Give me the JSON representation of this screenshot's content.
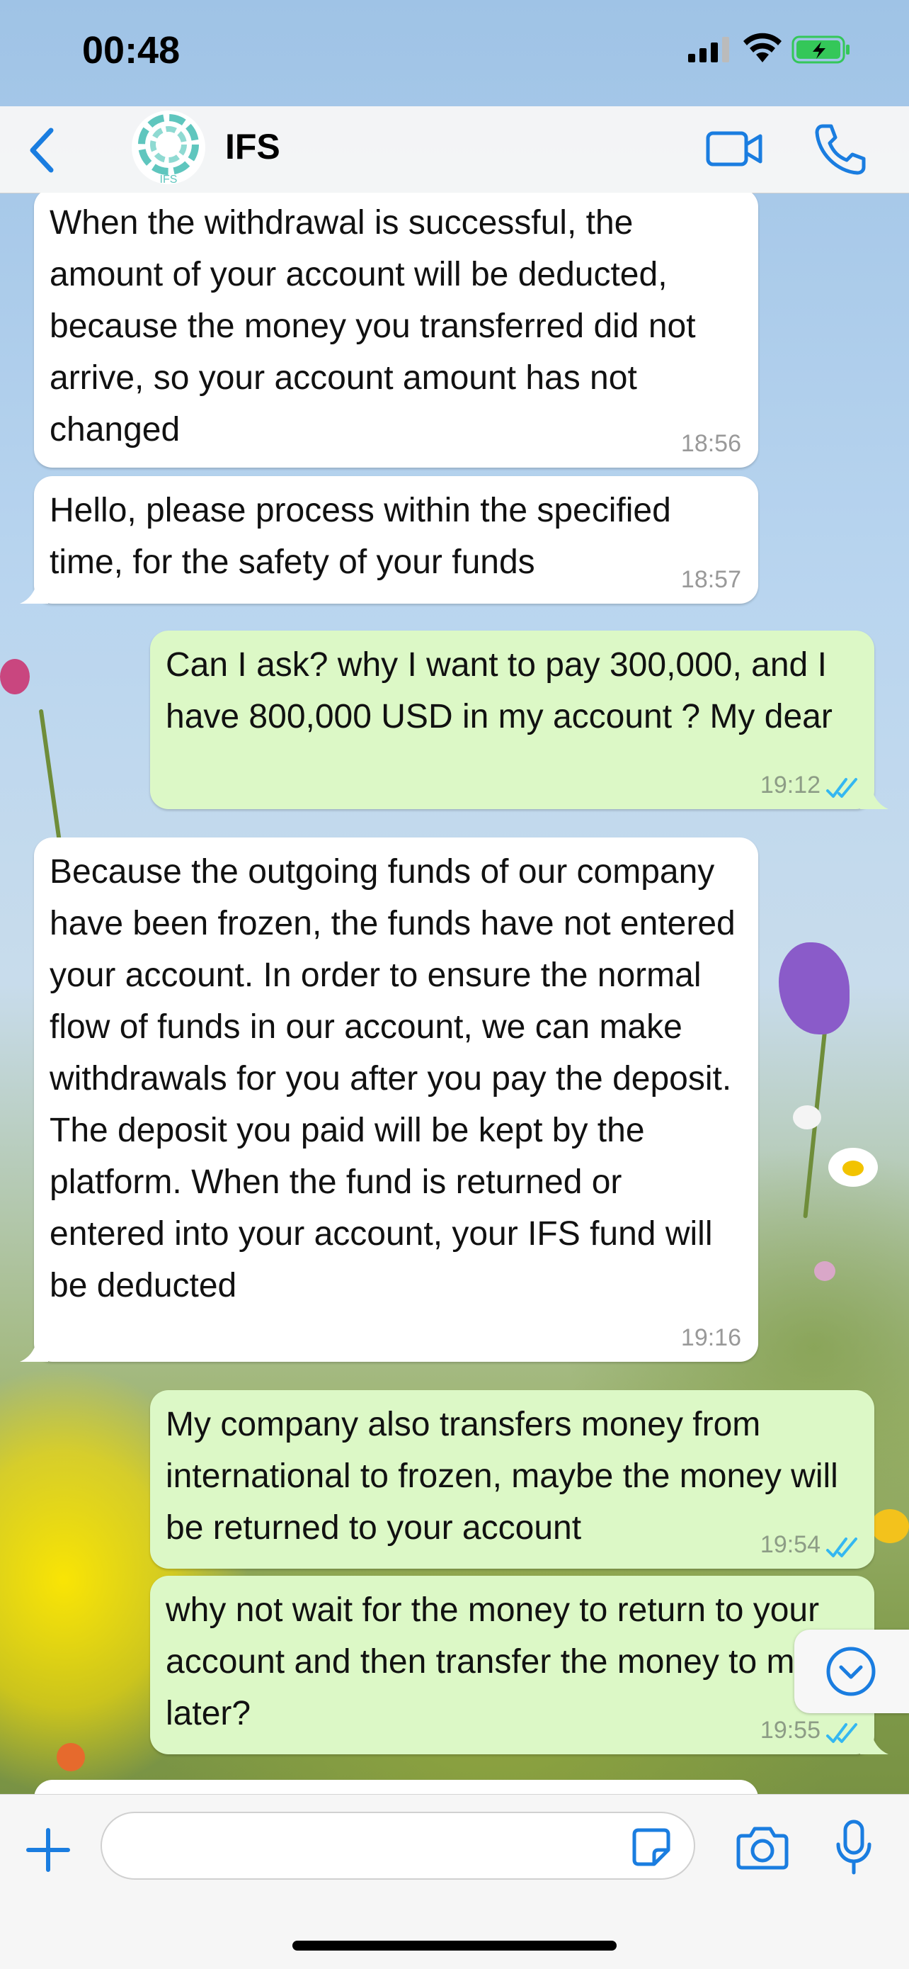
{
  "status_bar": {
    "time": "00:48"
  },
  "header": {
    "contact_name": "IFS",
    "avatar_text": "IFS"
  },
  "messages": [
    {
      "direction": "in",
      "text": "When the withdrawal is successful, the amount of your account will be deducted, because the money you transferred did not arrive, so your account amount has not changed",
      "time": "18:56"
    },
    {
      "direction": "in",
      "text": "Hello, please process within the specified time, for the safety of your funds",
      "time": "18:57"
    },
    {
      "direction": "out",
      "text": "Can I ask? why I want to pay 300,000, and I have 800,000 USD in my account  ? My dear",
      "time": "19:12",
      "status": "read"
    },
    {
      "direction": "in",
      "text": "Because the outgoing funds of our company have been frozen, the funds have not entered your account. In order to ensure the normal flow of funds in our account, we can make withdrawals for you after you pay the deposit. The deposit you paid will be kept by the platform. When the fund is returned or entered into your account, your IFS fund will be deducted",
      "time": "19:16"
    },
    {
      "direction": "out",
      "text": "My company also transfers money from international to frozen, maybe the money will be returned to your account",
      "time": "19:54",
      "status": "read"
    },
    {
      "direction": "out",
      "text": "why not wait for the money to return to your account and then transfer the money to me later?",
      "time": "19:55",
      "status": "read"
    }
  ],
  "input": {
    "placeholder": "",
    "value": ""
  },
  "colors": {
    "accent": "#1a7de0",
    "incoming_bubble": "#ffffff",
    "outgoing_bubble": "#dcf8c6",
    "read_ticks": "#34b7f1",
    "battery": "#34c759"
  },
  "icons": [
    "signal-icon",
    "wifi-icon",
    "battery-icon",
    "back-chevron-icon",
    "video-camera-icon",
    "phone-icon",
    "chevron-down-icon",
    "plus-icon",
    "sticker-icon",
    "camera-icon",
    "microphone-icon"
  ]
}
